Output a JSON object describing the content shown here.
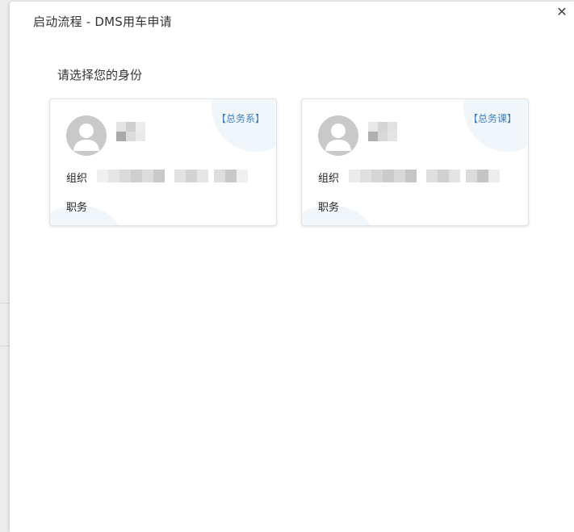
{
  "dialog": {
    "title": "启动流程 - DMS用车申请",
    "close_symbol": "✕"
  },
  "prompt": "请选择您的身份",
  "cards": [
    {
      "tag": "【总务系】",
      "org_label": "组织",
      "duty_label": "职务"
    },
    {
      "tag": "【总务课】",
      "org_label": "组织",
      "duty_label": "职务"
    }
  ],
  "icons": {
    "close": "close-icon",
    "avatar": "user-avatar-icon"
  },
  "colors": {
    "tag_text": "#3e7fc0",
    "decoration": "#f1f6fb",
    "avatar_bg": "#c9c9c9"
  }
}
